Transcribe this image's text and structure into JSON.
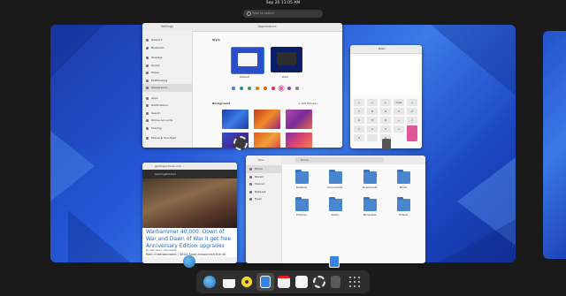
{
  "top_bar": {
    "clock": "Sep 20  11:05 AM"
  },
  "search": {
    "placeholder": "Type to search"
  },
  "settings": {
    "title_left": "Settings",
    "title_right": "Appearance",
    "sidebar": [
      "Network",
      "Bluetooth",
      "Displays",
      "Sound",
      "Power",
      "Multitasking",
      "Appearance",
      "Apps",
      "Notifications",
      "Search",
      "Online Accounts",
      "Sharing",
      "Mouse & Touchpad"
    ],
    "style_label": "Style",
    "style_options": [
      "Default",
      "Dark"
    ],
    "background_label": "Background",
    "add_picture": "+ Add Picture..."
  },
  "calculator": {
    "mode": "Basic",
    "keys": [
      [
        "÷",
        "←",
        "←",
        "mod",
        "÷"
      ],
      [
        "7",
        "8",
        "9",
        "×",
        "x²"
      ],
      [
        "4",
        "5",
        "6",
        "−",
        "√"
      ],
      [
        "1",
        "2",
        "3",
        "+",
        ""
      ],
      [
        "0",
        ".",
        "%",
        "",
        ""
      ]
    ]
  },
  "files": {
    "title": "Files",
    "path": "Home",
    "sidebar": [
      "Home",
      "Recent",
      "Starred",
      "Network",
      "Trash"
    ],
    "folders": [
      "Desktop",
      "Documents",
      "Downloads",
      "Music",
      "Pictures",
      "Public",
      "Templates",
      "Videos"
    ]
  },
  "browser": {
    "url": "gamingonlinux.com",
    "site": "GamingOnLinux",
    "headline": "Warhammer 40,000: Down of War and Dawn of War II get free Anniversary Edition upgrades",
    "byline": "By Liam Dawe - Wednesday",
    "excerpt": "Relic Entertainment / SEGA have announced the 40"
  },
  "colors": {
    "accent": "#3584e4",
    "wallpaper_dark": "#1c3aa8",
    "wallpaper_light": "#3d7be8",
    "dock": "#2e2e2e"
  },
  "dock_icons": [
    "web-browser-icon",
    "calendar-icon",
    "rhythmbox-icon",
    "files-icon",
    "software-icon",
    "text-editor-icon",
    "settings-icon",
    "calculator-icon",
    "app-grid-icon"
  ]
}
